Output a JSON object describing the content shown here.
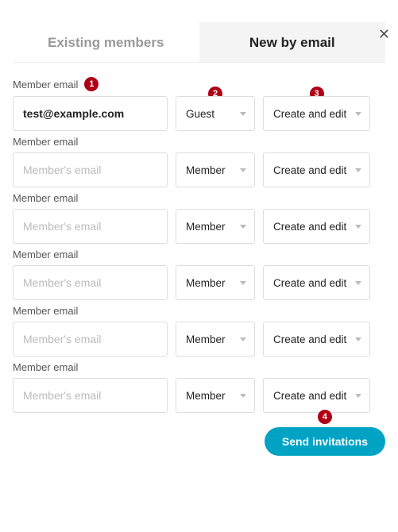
{
  "close_icon": "✕",
  "tabs": {
    "existing": "Existing members",
    "new": "New by email"
  },
  "email_label": "Member email",
  "email_placeholder": "Member's email",
  "badges": {
    "b1": "1",
    "b2": "2",
    "b3": "3",
    "b4": "4"
  },
  "rows": [
    {
      "email": "test@example.com",
      "role": "Guest",
      "access": "Create and edit"
    },
    {
      "email": "",
      "role": "Member",
      "access": "Create and edit"
    },
    {
      "email": "",
      "role": "Member",
      "access": "Create and edit"
    },
    {
      "email": "",
      "role": "Member",
      "access": "Create and edit"
    },
    {
      "email": "",
      "role": "Member",
      "access": "Create and edit"
    },
    {
      "email": "",
      "role": "Member",
      "access": "Create and edit"
    }
  ],
  "send_button": "Send invitations"
}
